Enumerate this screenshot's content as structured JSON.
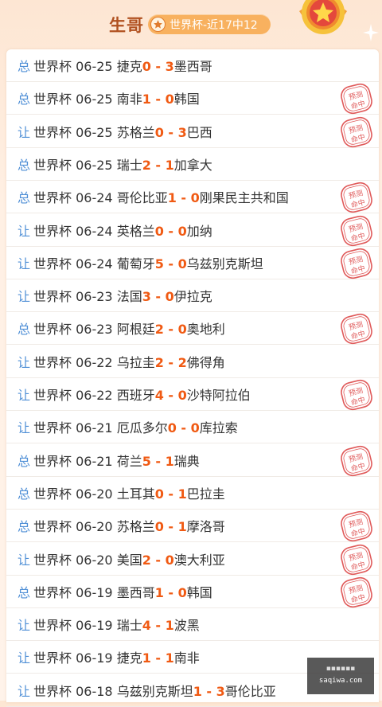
{
  "header": {
    "name": "生哥",
    "record_label": "世界杯-近17中12"
  },
  "stamp_text": "预测命中",
  "colors": {
    "tag": "#4f8fd6",
    "score": "#f05a13",
    "stamp": "#e05a5a",
    "name": "#b0501f"
  },
  "matches": [
    {
      "type": "总",
      "league": "世界杯",
      "date": "06-25",
      "home": "捷克",
      "hs": "0",
      "as": "3",
      "away": "墨西哥",
      "hit": false
    },
    {
      "type": "总",
      "league": "世界杯",
      "date": "06-25",
      "home": "南非",
      "hs": "1",
      "as": "0",
      "away": "韩国",
      "hit": true
    },
    {
      "type": "让",
      "league": "世界杯",
      "date": "06-25",
      "home": "苏格兰",
      "hs": "0",
      "as": "3",
      "away": "巴西",
      "hit": true
    },
    {
      "type": "总",
      "league": "世界杯",
      "date": "06-25",
      "home": "瑞士",
      "hs": "2",
      "as": "1",
      "away": "加拿大",
      "hit": false
    },
    {
      "type": "总",
      "league": "世界杯",
      "date": "06-24",
      "home": "哥伦比亚",
      "hs": "1",
      "as": "0",
      "away": "刚果民主共和国",
      "hit": true
    },
    {
      "type": "让",
      "league": "世界杯",
      "date": "06-24",
      "home": "英格兰",
      "hs": "0",
      "as": "0",
      "away": "加纳",
      "hit": true
    },
    {
      "type": "让",
      "league": "世界杯",
      "date": "06-24",
      "home": "葡萄牙",
      "hs": "5",
      "as": "0",
      "away": "乌兹别克斯坦",
      "hit": true
    },
    {
      "type": "让",
      "league": "世界杯",
      "date": "06-23",
      "home": "法国",
      "hs": "3",
      "as": "0",
      "away": "伊拉克",
      "hit": false
    },
    {
      "type": "总",
      "league": "世界杯",
      "date": "06-23",
      "home": "阿根廷",
      "hs": "2",
      "as": "0",
      "away": "奥地利",
      "hit": true
    },
    {
      "type": "让",
      "league": "世界杯",
      "date": "06-22",
      "home": "乌拉圭",
      "hs": "2",
      "as": "2",
      "away": "佛得角",
      "hit": false
    },
    {
      "type": "让",
      "league": "世界杯",
      "date": "06-22",
      "home": "西班牙",
      "hs": "4",
      "as": "0",
      "away": "沙特阿拉伯",
      "hit": true
    },
    {
      "type": "让",
      "league": "世界杯",
      "date": "06-21",
      "home": "厄瓜多尔",
      "hs": "0",
      "as": "0",
      "away": "库拉索",
      "hit": false
    },
    {
      "type": "总",
      "league": "世界杯",
      "date": "06-21",
      "home": "荷兰",
      "hs": "5",
      "as": "1",
      "away": "瑞典",
      "hit": true
    },
    {
      "type": "总",
      "league": "世界杯",
      "date": "06-20",
      "home": "土耳其",
      "hs": "0",
      "as": "1",
      "away": "巴拉圭",
      "hit": false
    },
    {
      "type": "总",
      "league": "世界杯",
      "date": "06-20",
      "home": "苏格兰",
      "hs": "0",
      "as": "1",
      "away": "摩洛哥",
      "hit": true
    },
    {
      "type": "让",
      "league": "世界杯",
      "date": "06-20",
      "home": "美国",
      "hs": "2",
      "as": "0",
      "away": "澳大利亚",
      "hit": true
    },
    {
      "type": "总",
      "league": "世界杯",
      "date": "06-19",
      "home": "墨西哥",
      "hs": "1",
      "as": "0",
      "away": "韩国",
      "hit": true
    },
    {
      "type": "让",
      "league": "世界杯",
      "date": "06-19",
      "home": "瑞士",
      "hs": "4",
      "as": "1",
      "away": "波黑",
      "hit": false
    },
    {
      "type": "让",
      "league": "世界杯",
      "date": "06-19",
      "home": "捷克",
      "hs": "1",
      "as": "1",
      "away": "南非",
      "hit": false
    },
    {
      "type": "让",
      "league": "世界杯",
      "date": "06-18",
      "home": "乌兹别克斯坦",
      "hs": "1",
      "as": "3",
      "away": "哥伦比亚",
      "hit": false
    }
  ],
  "watermark": {
    "line1": "▪▪▪▪▪▪",
    "line2": "saqiwa.com"
  }
}
